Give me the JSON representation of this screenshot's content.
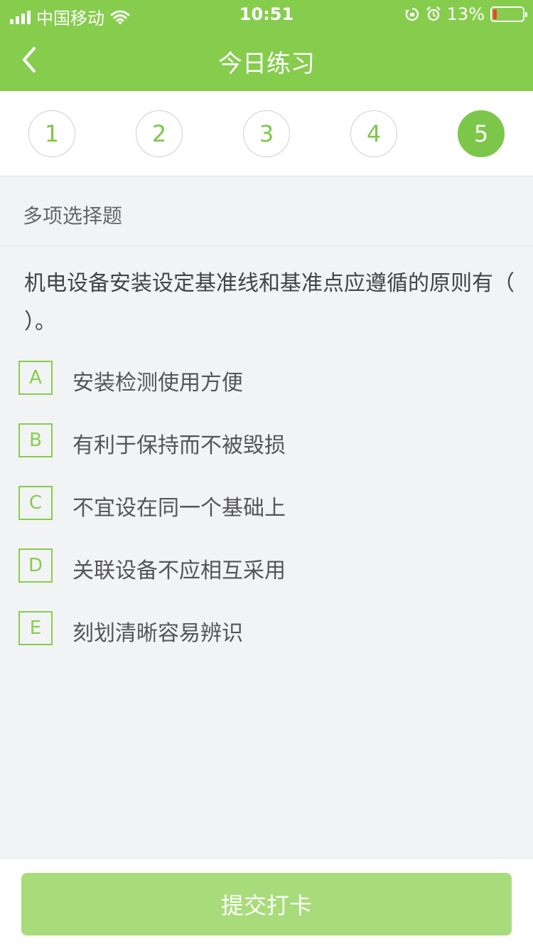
{
  "status_bar": {
    "carrier": "中国移动",
    "time": "10:51",
    "battery_percent": "13%",
    "icons": [
      "signal-icon",
      "wifi-icon",
      "rotation-lock-icon",
      "alarm-icon",
      "battery-icon"
    ],
    "battery_level": 0.13
  },
  "nav": {
    "title": "今日练习",
    "back_icon": "chevron-left-icon"
  },
  "steps": [
    {
      "label": "1",
      "active": false
    },
    {
      "label": "2",
      "active": false
    },
    {
      "label": "3",
      "active": false
    },
    {
      "label": "4",
      "active": false
    },
    {
      "label": "5",
      "active": true
    }
  ],
  "question": {
    "type": "多项选择题",
    "text": "机电设备安装设定基准线和基准点应遵循的原则有（ ）。",
    "options": [
      {
        "key": "A",
        "text": "安装检测使用方便"
      },
      {
        "key": "B",
        "text": "有利于保持而不被毁损"
      },
      {
        "key": "C",
        "text": "不宜设在同一个基础上"
      },
      {
        "key": "D",
        "text": "关联设备不应相互采用"
      },
      {
        "key": "E",
        "text": "刻划清晰容易辨识"
      }
    ]
  },
  "footer": {
    "submit_label": "提交打卡"
  },
  "colors": {
    "accent": "#86cc4d",
    "step_active": "#7cc74a",
    "submit_bg": "#a8dc7a",
    "battery_low": "#ff3b30"
  }
}
